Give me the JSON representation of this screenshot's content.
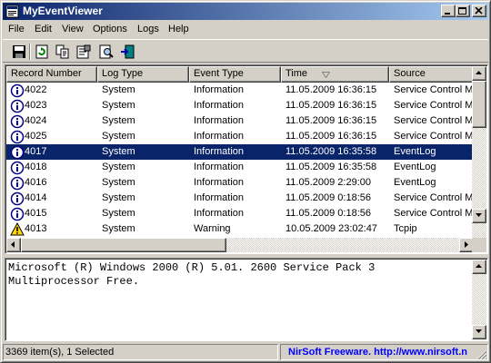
{
  "window": {
    "title": "MyEventViewer"
  },
  "menu": [
    "File",
    "Edit",
    "View",
    "Options",
    "Logs",
    "Help"
  ],
  "toolbar": {
    "items": [
      "save-icon",
      "refresh-icon",
      "copy-icon",
      "properties-icon",
      "find-icon",
      "exit-icon"
    ]
  },
  "columns": [
    "Record Number",
    "Log Type",
    "Event Type",
    "Time",
    "Source"
  ],
  "rows": [
    {
      "icon": "info",
      "record": "4022",
      "log": "System",
      "event": "Information",
      "time": "11.05.2009 16:36:15",
      "source": "Service Control Ma"
    },
    {
      "icon": "info",
      "record": "4023",
      "log": "System",
      "event": "Information",
      "time": "11.05.2009 16:36:15",
      "source": "Service Control Ma"
    },
    {
      "icon": "info",
      "record": "4024",
      "log": "System",
      "event": "Information",
      "time": "11.05.2009 16:36:15",
      "source": "Service Control Ma"
    },
    {
      "icon": "info",
      "record": "4025",
      "log": "System",
      "event": "Information",
      "time": "11.05.2009 16:36:15",
      "source": "Service Control Ma"
    },
    {
      "icon": "info",
      "record": "4017",
      "log": "System",
      "event": "Information",
      "time": "11.05.2009 16:35:58",
      "source": "EventLog",
      "selected": true
    },
    {
      "icon": "info",
      "record": "4018",
      "log": "System",
      "event": "Information",
      "time": "11.05.2009 16:35:58",
      "source": "EventLog"
    },
    {
      "icon": "info",
      "record": "4016",
      "log": "System",
      "event": "Information",
      "time": "11.05.2009 2:29:00",
      "source": "EventLog"
    },
    {
      "icon": "info",
      "record": "4014",
      "log": "System",
      "event": "Information",
      "time": "11.05.2009 0:18:56",
      "source": "Service Control Ma"
    },
    {
      "icon": "info",
      "record": "4015",
      "log": "System",
      "event": "Information",
      "time": "11.05.2009 0:18:56",
      "source": "Service Control Ma"
    },
    {
      "icon": "warning",
      "record": "4013",
      "log": "System",
      "event": "Warning",
      "time": "10.05.2009 23:02:47",
      "source": "Tcpip"
    }
  ],
  "description": "Microsoft (R) Windows 2000 (R) 5.01. 2600 Service Pack 3\nMultiprocessor Free.",
  "status": {
    "count": "3369 item(s), 1 Selected",
    "link": "NirSoft Freeware.  http://www.nirsoft.n"
  },
  "colors": {
    "selection": "#0a246a",
    "title_start": "#0a246a",
    "title_end": "#a6caf0",
    "link": "#0000ff"
  }
}
